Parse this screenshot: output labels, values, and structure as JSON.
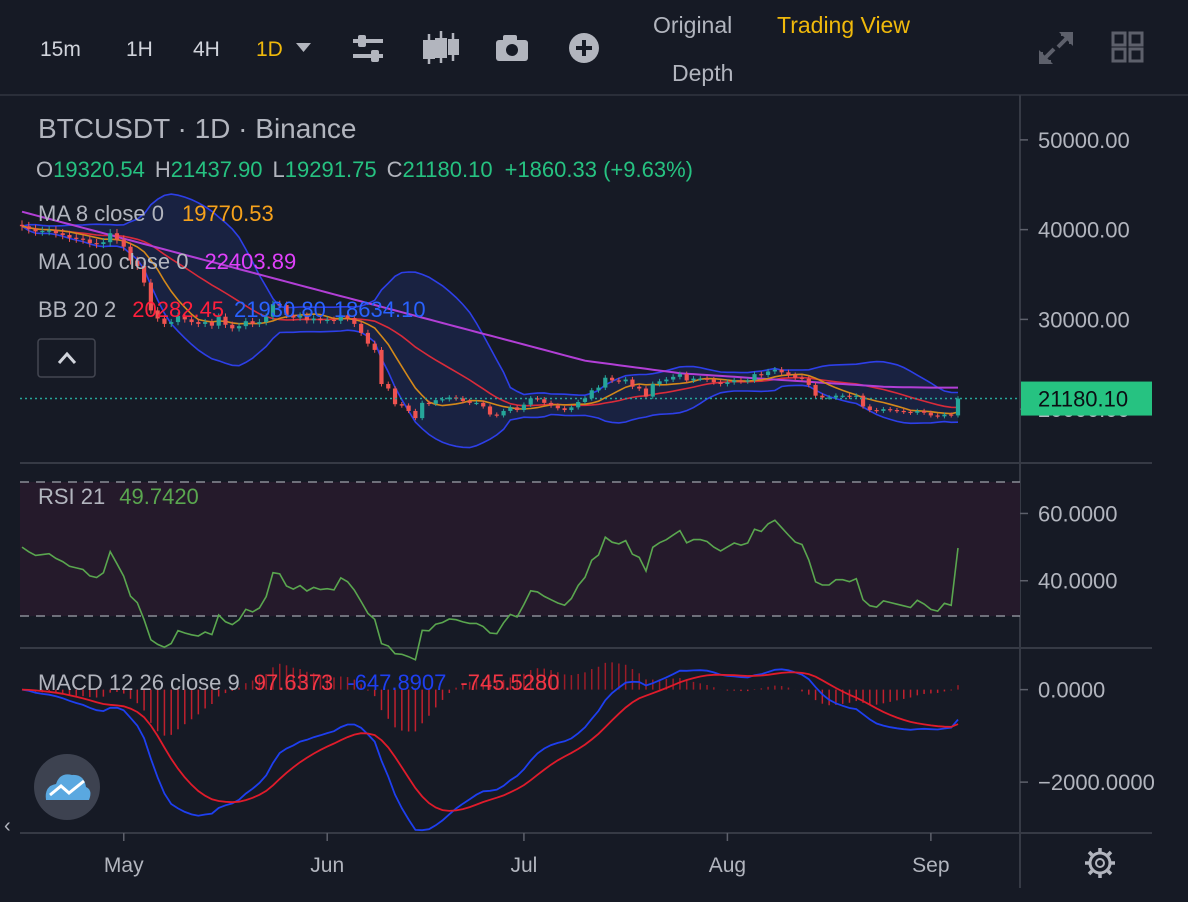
{
  "toolbar": {
    "intervals": [
      "15m",
      "1H",
      "4H"
    ],
    "active_interval": "1D",
    "view_tabs": [
      "Original",
      "Trading View",
      "Depth"
    ],
    "active_view": "Trading View"
  },
  "colors": {
    "background": "#161a25",
    "up": "#26a69a",
    "down": "#ef5350",
    "ma8": "#f7a21b",
    "ma100": "#c840e0",
    "bb_upper": "#ff1f3c",
    "bb_basis": "#f23645",
    "bb_lower": "#2962ff",
    "macd": "#1e3ff0",
    "signal": "#e01b2b",
    "rsi": "#5aa64f",
    "accent": "#f0b90b"
  },
  "legend": {
    "symbol": "BTCUSDT · 1D · Binance",
    "ohlc": {
      "o_label": "O",
      "o": "19320.54",
      "h_label": "H",
      "h": "21437.90",
      "l_label": "L",
      "l": "19291.75",
      "c_label": "C",
      "c": "21180.10",
      "change": "+1860.33 (+9.63%)"
    },
    "ma8_label": "MA 8 close 0",
    "ma8_value": "19770.53",
    "ma100_label": "MA 100 close 0",
    "ma100_value": "22403.89",
    "bb_label": "BB 20 2",
    "bb_upper": "20282.45",
    "bb_basis": "21930.80",
    "bb_lower": "18634.10"
  },
  "last_price_label": "21180.10",
  "rsi_legend": {
    "label": "RSI 21",
    "value": "49.7420"
  },
  "macd_legend": {
    "label": "MACD 12 26 close 9",
    "hist": "97.6373",
    "macd": "-647.8907",
    "signal": "-745.5280"
  },
  "chart_data": {
    "type": "candlestick",
    "symbol": "BTCUSDT",
    "interval": "1D",
    "exchange": "Binance",
    "x_ticks": [
      "May",
      "Jun",
      "Jul",
      "Aug",
      "Sep"
    ],
    "price_axis": {
      "ticks": [
        50000,
        40000,
        30000,
        20000
      ],
      "tick_labels": [
        "50000.00",
        "40000.00",
        "30000.00",
        "20000.00"
      ],
      "range": [
        14000,
        55000
      ]
    },
    "last_close": 21180.1,
    "close": [
      40380,
      40050,
      39800,
      39850,
      39900,
      39600,
      39400,
      39100,
      39000,
      38900,
      38500,
      38400,
      38600,
      39600,
      38900,
      38100,
      36550,
      35950,
      34100,
      31000,
      30100,
      29500,
      29700,
      30400,
      30000,
      29700,
      29500,
      29700,
      29300,
      30300,
      29400,
      29000,
      29250,
      29800,
      29500,
      29700,
      30300,
      31700,
      31600,
      30500,
      30200,
      30400,
      29900,
      30100,
      29900,
      29950,
      29850,
      30450,
      30150,
      29500,
      28500,
      27300,
      26600,
      22800,
      22300,
      20550,
      20400,
      19800,
      19000,
      20700,
      20600,
      21000,
      21100,
      21300,
      21200,
      20900,
      20700,
      20700,
      20300,
      19400,
      19300,
      19800,
      20200,
      19900,
      20500,
      21200,
      21100,
      20700,
      20400,
      20100,
      19900,
      20200,
      20800,
      21200,
      22100,
      22400,
      23500,
      23200,
      23100,
      23300,
      22500,
      22300,
      21400,
      22800,
      23100,
      23300,
      23600,
      23900,
      23200,
      23400,
      23400,
      23300,
      23000,
      22800,
      23000,
      23200,
      23100,
      23200,
      23900,
      23800,
      24200,
      24400,
      24100,
      23800,
      23500,
      23400,
      22700,
      21500,
      21300,
      21300,
      21500,
      21500,
      21400,
      21500,
      20300,
      19900,
      19800,
      20000,
      19900,
      19800,
      19700,
      19600,
      19800,
      19600,
      19300,
      19200,
      19400,
      19300,
      21180.1
    ],
    "ma100": [
      42000,
      41800,
      41600,
      41400,
      41200,
      41000,
      40800,
      40600,
      40400,
      40200,
      40000,
      39800,
      39600,
      39400,
      39200,
      39000,
      38800,
      38600,
      38400,
      38200,
      38000,
      37800,
      37600,
      37400,
      37200,
      37000,
      36800,
      36600,
      36400,
      36200,
      36000,
      35800,
      35600,
      35400,
      35200,
      35000,
      34800,
      34600,
      34400,
      34200,
      34000,
      33800,
      33600,
      33400,
      33200,
      33000,
      32800,
      32600,
      32400,
      32200,
      32000,
      31800,
      31600,
      31400,
      31200,
      31000,
      30800,
      30600,
      30400,
      30200,
      30000,
      29800,
      29600,
      29400,
      29200,
      29000,
      28800,
      28600,
      28400,
      28200,
      28000,
      27800,
      27600,
      27400,
      27200,
      27000,
      26800,
      26600,
      26400,
      26200,
      26000,
      25800,
      25600,
      25400,
      25300,
      25200,
      25100,
      25000,
      24900,
      24800,
      24700,
      24600,
      24500,
      24400,
      24300,
      24200,
      24100,
      24000,
      23950,
      23900,
      23850,
      23800,
      23750,
      23700,
      23650,
      23600,
      23550,
      23500,
      23450,
      23400,
      23350,
      23300,
      23250,
      23200,
      23150,
      23100,
      23050,
      23000,
      22950,
      22900,
      22850,
      22800,
      22750,
      22700,
      22650,
      22600,
      22550,
      22500,
      22480,
      22460,
      22440,
      22430,
      22420,
      22410,
      22405,
      22400,
      22400,
      22400,
      22403.89
    ],
    "rsi": {
      "range": [
        20,
        75
      ],
      "ticks": [
        60,
        40
      ],
      "tick_labels": [
        "60.0000",
        "40.0000"
      ],
      "bands": [
        70,
        30
      ],
      "last": 49.742
    },
    "macd_pane": {
      "ticks": [
        0,
        -2000
      ],
      "tick_labels": [
        "0.0000",
        "−2000.0000"
      ],
      "range": [
        -3100,
        900
      ],
      "hist_last": 97.6373,
      "macd_last": -647.8907,
      "signal_last": -745.528
    }
  }
}
